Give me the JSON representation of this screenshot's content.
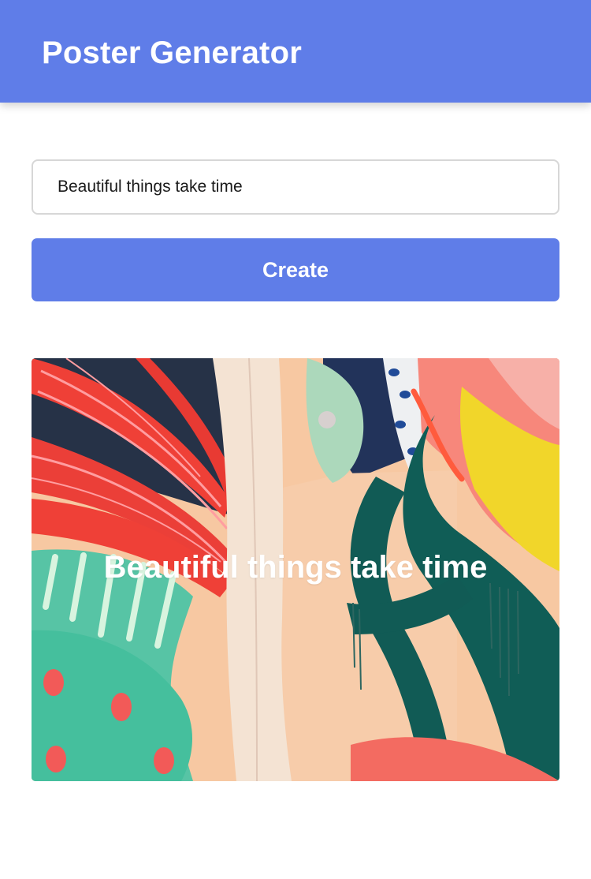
{
  "colors": {
    "primary": "#5f7de8",
    "surface": "#ffffff",
    "input_border": "#d7d7d7",
    "poster_caption": "#ffffff"
  },
  "header": {
    "title": "Poster Generator"
  },
  "form": {
    "input_value": "Beautiful things take time",
    "create_label": "Create"
  },
  "poster": {
    "caption": "Beautiful things take time",
    "image_icon": "abstract-painting-artwork"
  }
}
